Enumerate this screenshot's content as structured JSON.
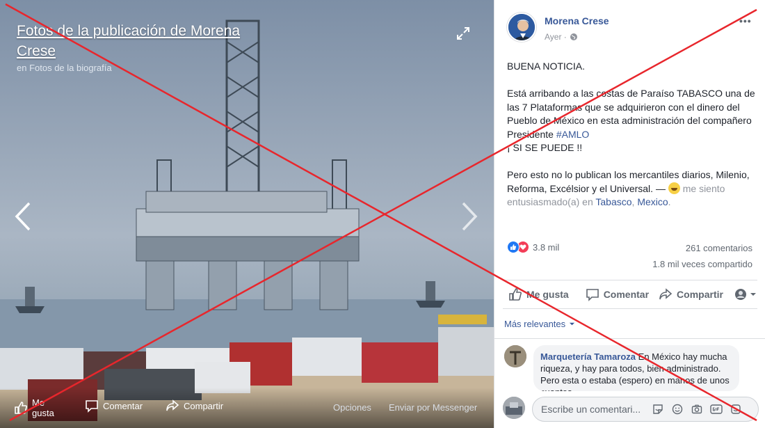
{
  "viewer": {
    "title": "Fotos de la publicación de Morena Crese",
    "subtitle": "en Fotos de la biografía",
    "bar": {
      "like_label": "Me gusta",
      "comment_label": "Comentar",
      "share_label": "Compartir",
      "options_label": "Opciones",
      "messenger_label": "Enviar por Messenger"
    }
  },
  "post": {
    "page_name": "Morena Crese",
    "time": "Ayer ·",
    "more": "•••",
    "text": {
      "p1": "BUENA NOTICIA.",
      "p2_l1": "Está arribando a las costas de Paraíso TABASCO una de las 7 Plataformas que se adquirieron con el dinero del Pueblo de México en esta administración del compañero Presidente ",
      "hashtag": "#AMLO",
      "p2_l2": "¡ SI SE PUEDE !!",
      "p3": "Pero esto no lo publican los mercantiles diarios, Milenio, Reforma, Excélsior y el Universal. — ",
      "feeling": " me siento entusiasmado(a) en ",
      "loc1": "Tabasco",
      "loc_sep": ", ",
      "loc2": "Mexico",
      "end": "."
    },
    "reactions_count": "3.8 mil",
    "comments_count": "261 comentarios",
    "shares_count": "1.8 mil veces compartido",
    "actions": {
      "like": "Me gusta",
      "comment": "Comentar",
      "share": "Compartir"
    },
    "sort_label": "Más relevantes",
    "comment": {
      "author": "Marquetería Tamaroza",
      "text": " En México hay mucha riqueza, y hay para todos, bien administrado. Pero esta o estaba (espero) en manos de unos cuantos..."
    },
    "composer_placeholder": "Escribe un comentari..."
  },
  "colors": {
    "brand_link": "#385898",
    "like_blue": "#2078f4",
    "love_red": "#f33e58",
    "cross_red": "#e8262c"
  }
}
